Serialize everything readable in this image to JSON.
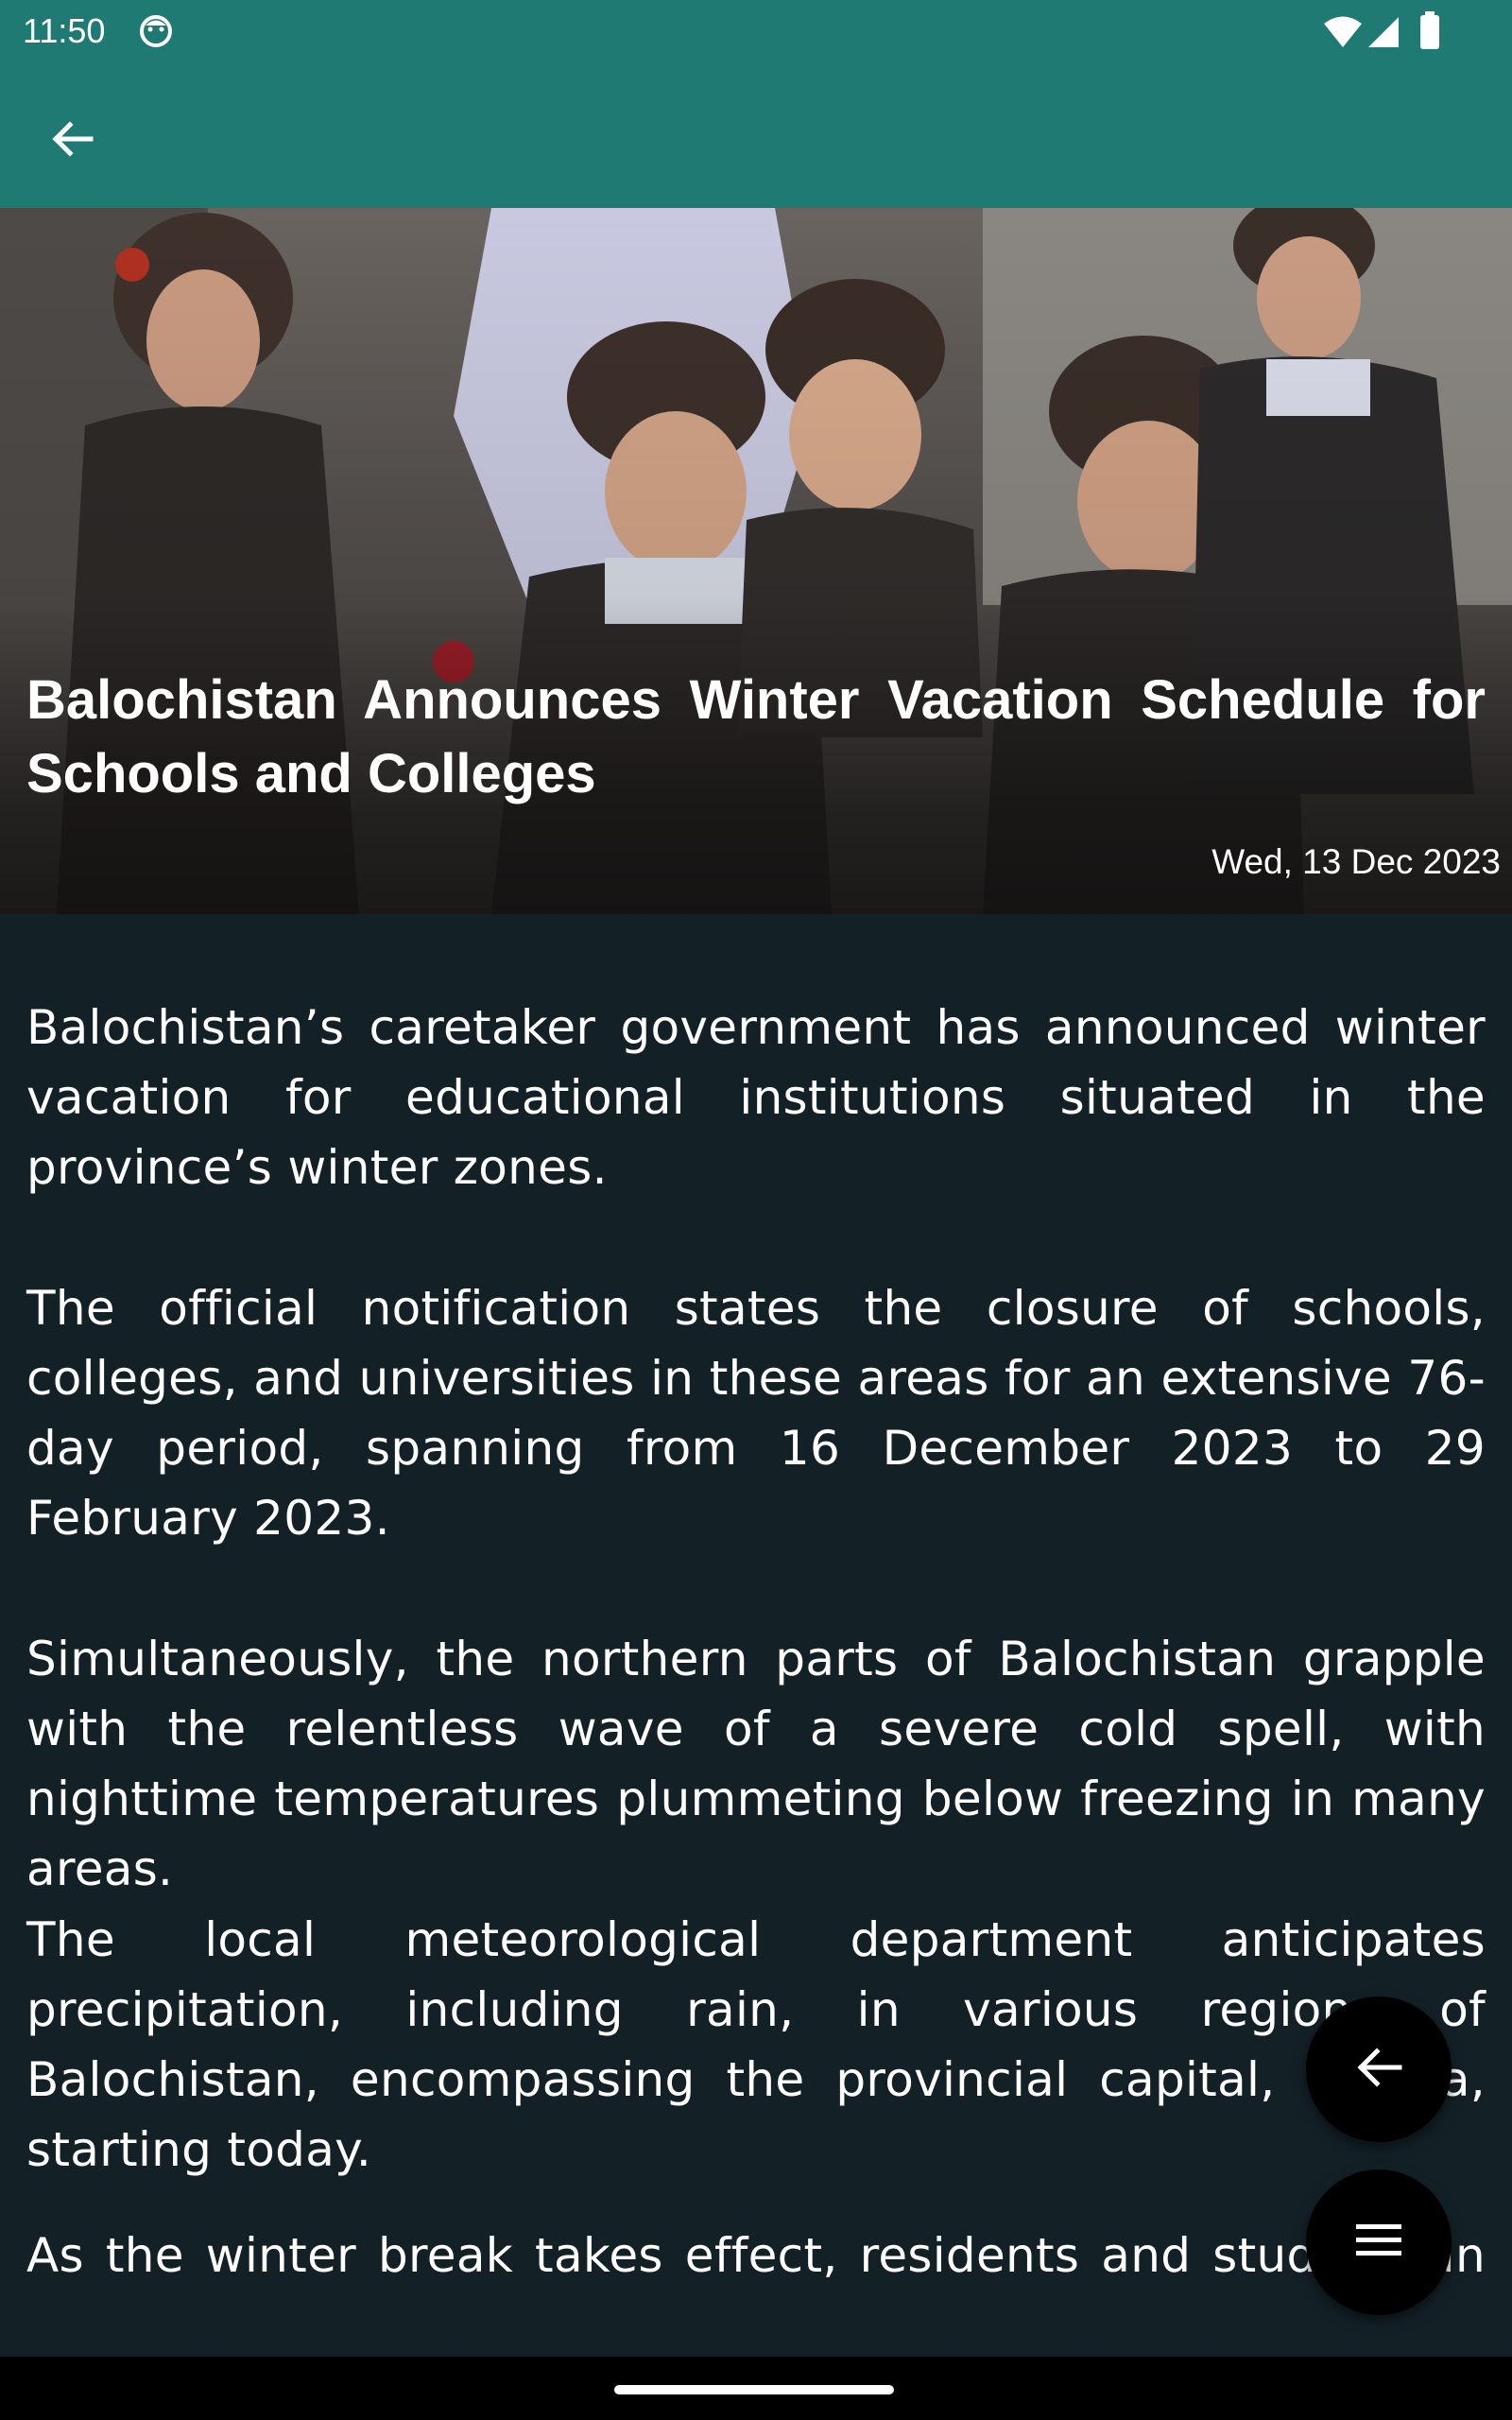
{
  "status_bar": {
    "time": "11:50",
    "icons": [
      "face-notification-icon",
      "wifi-icon",
      "signal-icon",
      "battery-icon"
    ]
  },
  "app_bar": {
    "back_icon": "arrow-back-icon",
    "background_color": "#1f7a74"
  },
  "article": {
    "title": "Balochistan Announces Winter Vacation Schedule for Schools and Colleges",
    "date": "Wed, 13 Dec 2023",
    "paragraphs": [
      "Balochistan’s caretaker government has announced winter vacation for educational institutions situated in the province’s winter zones.",
      "The official notification states the closure of schools, colleges, and universities in these areas for an extensive 76-day period, spanning from 16 December 2023 to 29 February 2023.",
      "Simultaneously, the northern parts of Balochistan grapple with the relentless wave of a severe cold spell, with nighttime temperatures plummeting below freezing in many areas.",
      "The local meteorological department anticipates precipitation, including rain, in various regions of Balochistan, encompassing the provincial capital, Quetta, starting today.",
      "As the winter break takes effect, residents and students in"
    ],
    "background_color": "#132127"
  },
  "fabs": {
    "back_icon": "arrow-back-icon",
    "menu_icon": "menu-icon"
  }
}
